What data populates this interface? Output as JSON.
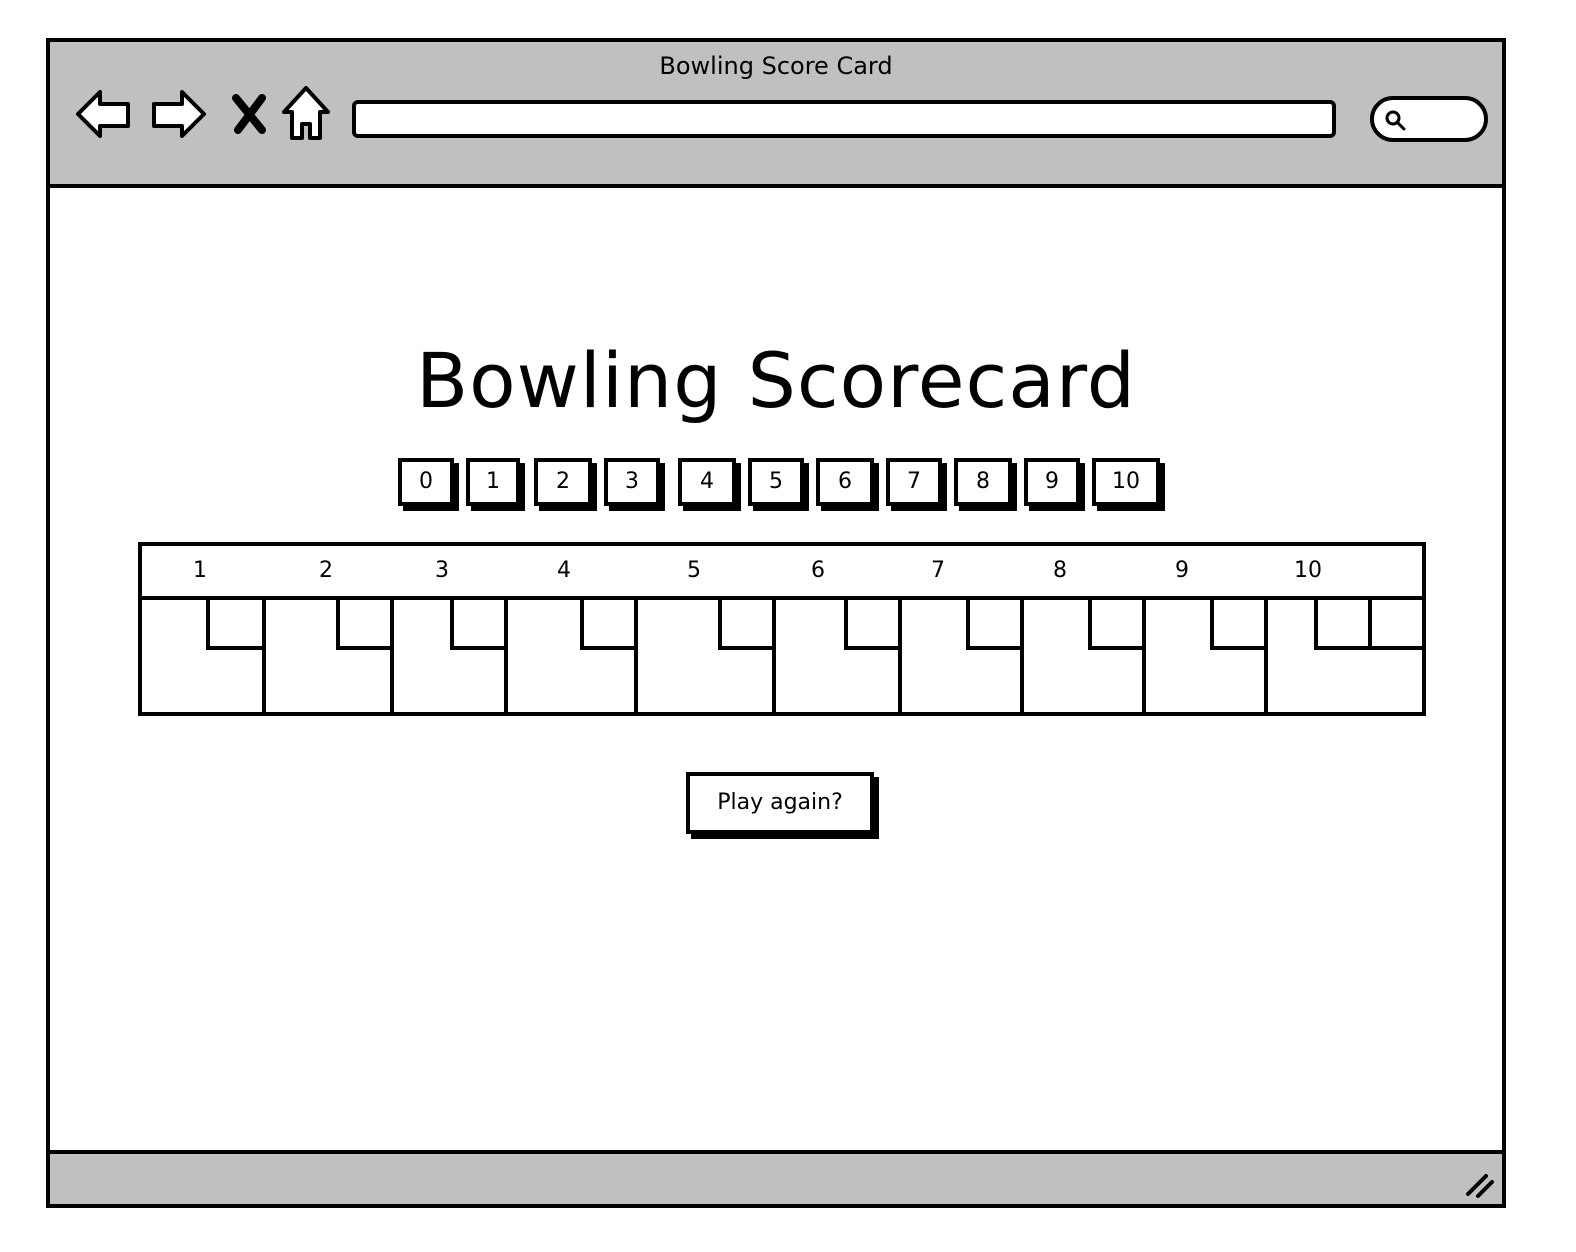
{
  "window": {
    "title": "Bowling Score Card"
  },
  "toolbar": {
    "back_icon": "back-arrow-icon",
    "forward_icon": "forward-arrow-icon",
    "stop_icon": "close-icon",
    "home_icon": "home-icon",
    "url_value": "",
    "search_icon": "search-icon"
  },
  "main": {
    "title": "Bowling Scorecard",
    "pin_buttons": [
      "0",
      "1",
      "2",
      "3",
      "4",
      "5",
      "6",
      "7",
      "8",
      "9",
      "10"
    ],
    "frames": [
      {
        "label": "1",
        "rolls": [
          "",
          ""
        ],
        "total": ""
      },
      {
        "label": "2",
        "rolls": [
          "",
          ""
        ],
        "total": ""
      },
      {
        "label": "3",
        "rolls": [
          "",
          ""
        ],
        "total": ""
      },
      {
        "label": "4",
        "rolls": [
          "",
          ""
        ],
        "total": ""
      },
      {
        "label": "5",
        "rolls": [
          "",
          ""
        ],
        "total": ""
      },
      {
        "label": "6",
        "rolls": [
          "",
          ""
        ],
        "total": ""
      },
      {
        "label": "7",
        "rolls": [
          "",
          ""
        ],
        "total": ""
      },
      {
        "label": "8",
        "rolls": [
          "",
          ""
        ],
        "total": ""
      },
      {
        "label": "9",
        "rolls": [
          "",
          ""
        ],
        "total": ""
      },
      {
        "label": "10",
        "rolls": [
          "",
          "",
          ""
        ],
        "total": ""
      }
    ],
    "play_again_label": "Play again?"
  },
  "colors": {
    "chrome": "#c0c0c0",
    "ink": "#000000",
    "page": "#ffffff"
  }
}
